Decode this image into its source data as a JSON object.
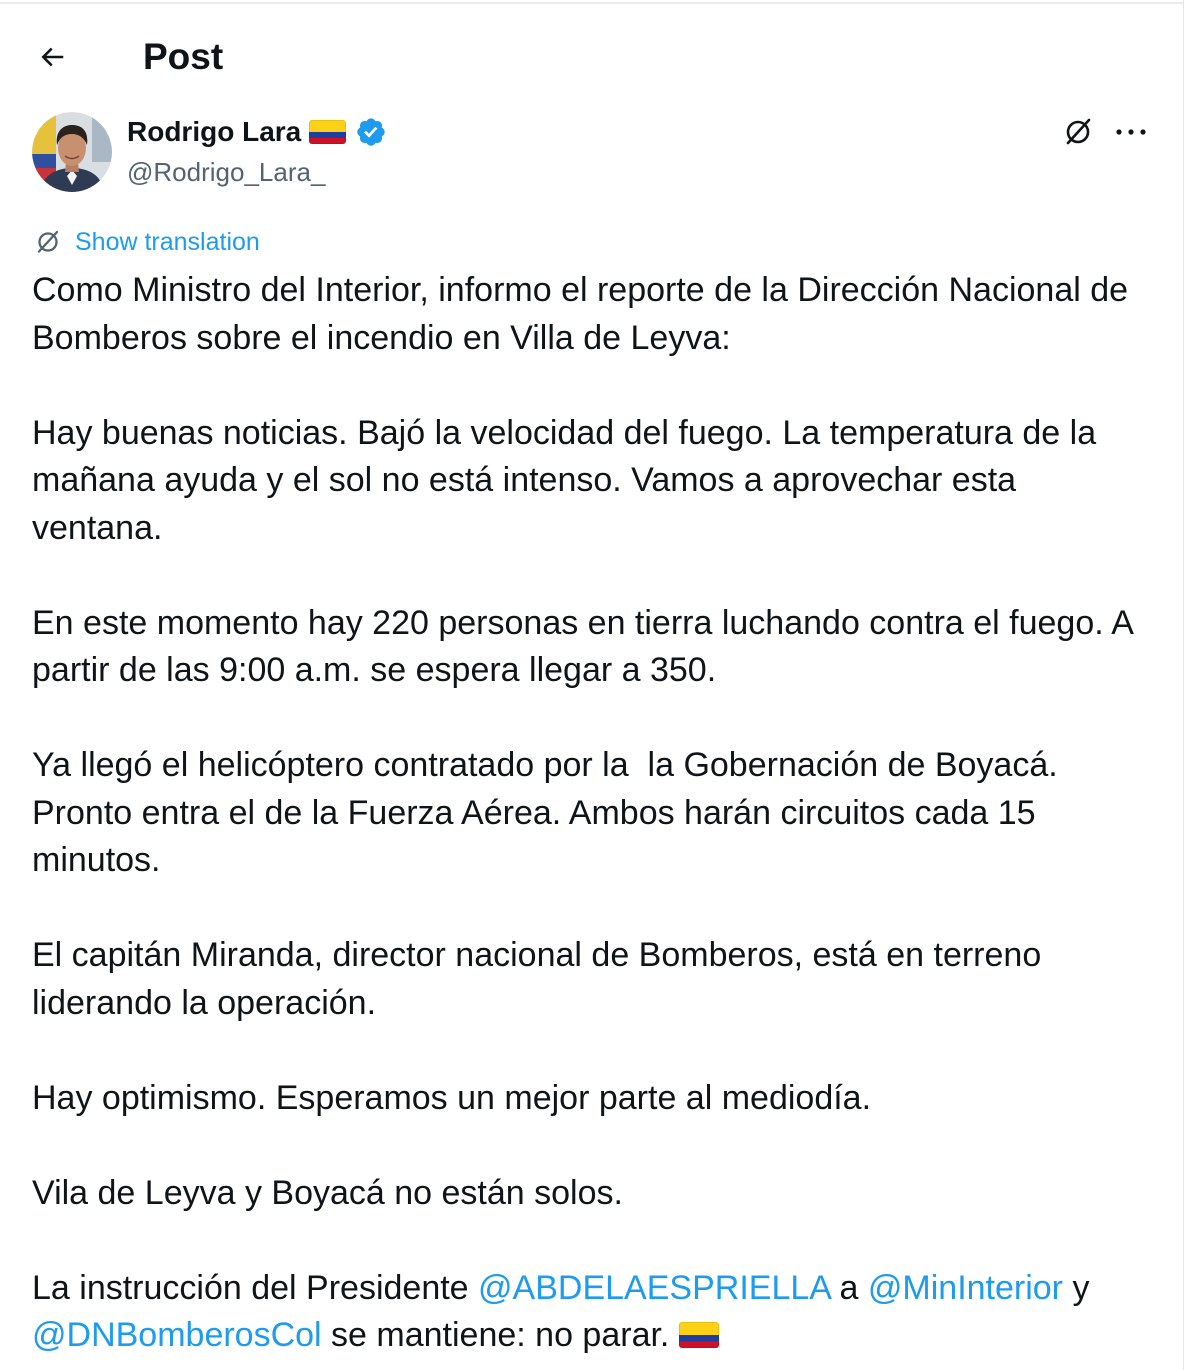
{
  "header": {
    "back_icon": "arrow-left-icon",
    "title": "Post"
  },
  "author": {
    "name": "Rodrigo Lara",
    "name_flag_icon": "colombia-flag-icon",
    "verified_icon": "verified-badge-icon",
    "handle": "@Rodrigo_Lara_"
  },
  "actions": {
    "grok_icon": "grok-icon",
    "more_icon": "more-dots-icon"
  },
  "translation": {
    "icon": "grok-translate-icon",
    "label": "Show translation"
  },
  "body": {
    "paragraphs": [
      [
        "Como Ministro del Interior, informo el reporte de la Dirección Nacional de",
        "Bomberos sobre el incendio en Villa de Leyva:"
      ],
      [
        "Hay buenas noticias. Bajó la velocidad del fuego. La temperatura de la",
        "mañana ayuda y el sol no está intenso. Vamos a aprovechar esta",
        "ventana."
      ],
      [
        "En este momento hay 220 personas en tierra luchando contra el fuego. A",
        "partir de las 9:00 a.m. se espera llegar a 350."
      ],
      [
        "Ya llegó el helicóptero contratado por la  la Gobernación de Boyacá.",
        "Pronto entra el de la Fuerza Aérea. Ambos harán circuitos cada 15",
        "minutos."
      ],
      [
        "El capitán Miranda, director nacional de Bomberos, está en terreno",
        "liderando la operación."
      ],
      [
        "Hay optimismo. Esperamos un mejor parte al mediodía."
      ],
      [
        "Vila de Leyva y Boyacá no están solos."
      ]
    ],
    "closing": {
      "line1": {
        "text_before": "La instrucción del Presidente ",
        "mention1": "@ABDELAESPRIELLA",
        "text_mid": " a ",
        "mention2": "@MinInterior",
        "text_after": " y"
      },
      "line2": {
        "mention3": "@DNBomberosCol",
        "text_after": " se mantiene: no parar. ",
        "flag_icon": "colombia-flag-icon"
      }
    }
  },
  "colors": {
    "text": "#0f1419",
    "secondary": "#536471",
    "accent": "#1d9bf0",
    "verified": "#1d9bf0",
    "flag_yellow": "#fcd116",
    "flag_blue": "#1f3fa0",
    "flag_red": "#ce1126"
  }
}
